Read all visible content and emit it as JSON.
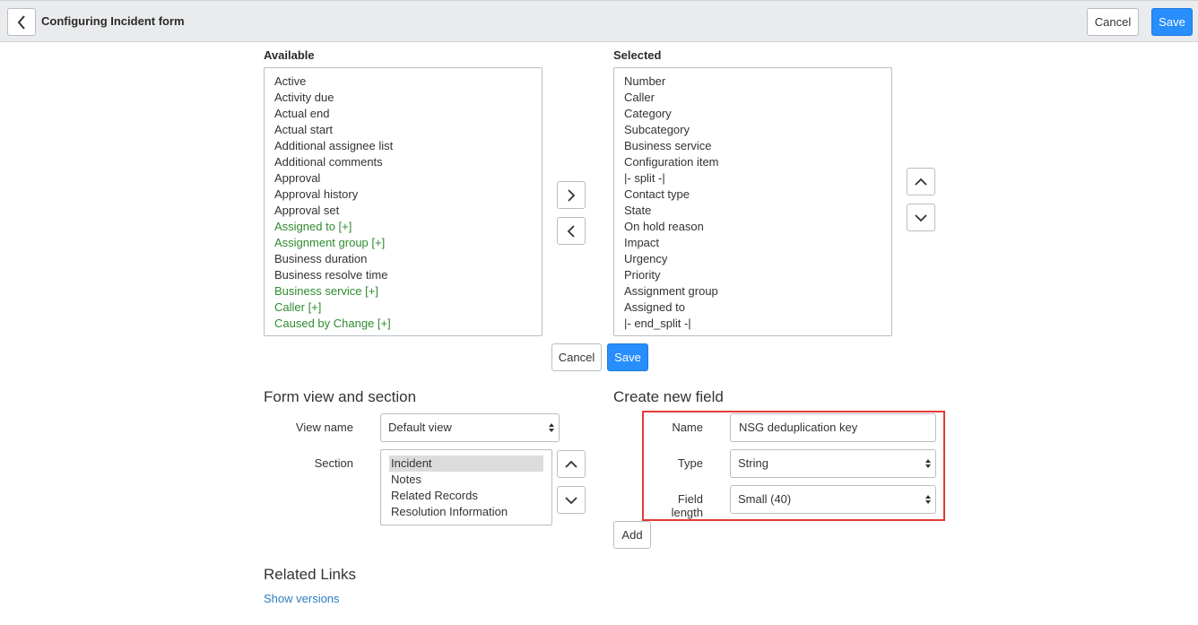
{
  "header": {
    "title": "Configuring Incident form",
    "cancel_label": "Cancel",
    "save_label": "Save"
  },
  "available": {
    "label": "Available",
    "items": [
      {
        "text": "Active",
        "ref": false
      },
      {
        "text": "Activity due",
        "ref": false
      },
      {
        "text": "Actual end",
        "ref": false
      },
      {
        "text": "Actual start",
        "ref": false
      },
      {
        "text": "Additional assignee list",
        "ref": false
      },
      {
        "text": "Additional comments",
        "ref": false
      },
      {
        "text": "Approval",
        "ref": false
      },
      {
        "text": "Approval history",
        "ref": false
      },
      {
        "text": "Approval set",
        "ref": false
      },
      {
        "text": "Assigned to [+]",
        "ref": true
      },
      {
        "text": "Assignment group [+]",
        "ref": true
      },
      {
        "text": "Business duration",
        "ref": false
      },
      {
        "text": "Business resolve time",
        "ref": false
      },
      {
        "text": "Business service [+]",
        "ref": true
      },
      {
        "text": "Caller [+]",
        "ref": true
      },
      {
        "text": "Caused by Change [+]",
        "ref": true
      }
    ]
  },
  "selected": {
    "label": "Selected",
    "items": [
      "Number",
      "Caller",
      "Category",
      "Subcategory",
      "Business service",
      "Configuration item",
      "|- split -|",
      "Contact type",
      "State",
      "On hold reason",
      "Impact",
      "Urgency",
      "Priority",
      "Assignment group",
      "Assigned to",
      "|- end_split -|"
    ]
  },
  "slush_actions": {
    "cancel_label": "Cancel",
    "save_label": "Save"
  },
  "form_view": {
    "title": "Form view and section",
    "view_name_label": "View name",
    "view_name_value": "Default view",
    "section_label": "Section",
    "sections": [
      "Incident",
      "Notes",
      "Related Records",
      "Resolution Information"
    ],
    "selected_section": "Incident"
  },
  "create_field": {
    "title": "Create new field",
    "name_label": "Name",
    "name_value": "NSG deduplication key",
    "type_label": "Type",
    "type_value": "String",
    "length_label": "Field length",
    "length_value": "Small (40)",
    "add_label": "Add"
  },
  "related_links": {
    "title": "Related Links",
    "show_versions": "Show versions"
  },
  "colors": {
    "primary": "#278efc",
    "reference_field": "#2e8b2e",
    "highlight": "#e53935",
    "link": "#2d7dbf"
  }
}
